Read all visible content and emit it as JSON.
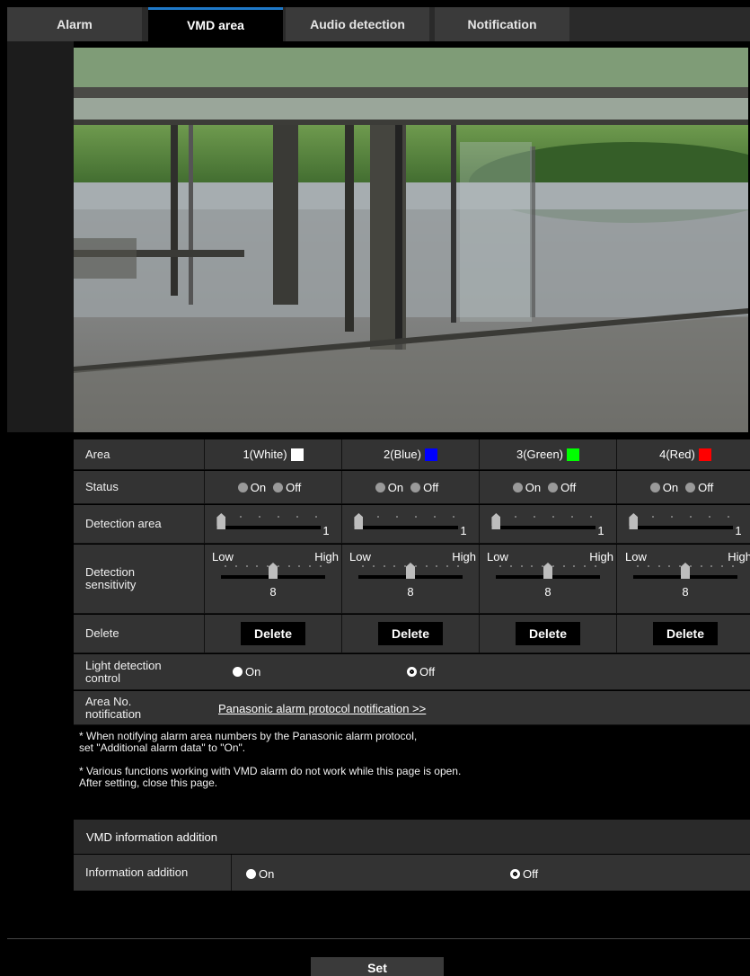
{
  "tabs": [
    {
      "label": "Alarm",
      "active": false
    },
    {
      "label": "VMD area",
      "active": true
    },
    {
      "label": "Audio detection",
      "active": false
    },
    {
      "label": "Notification",
      "active": false
    }
  ],
  "area_table": {
    "labels": {
      "area": "Area",
      "status": "Status",
      "detection_area": "Detection area",
      "detection_sensitivity": "Detection sensitivity",
      "delete": "Delete",
      "light_detection": "Light detection control",
      "area_no_notification": "Area No. notification"
    },
    "areas": [
      {
        "name": "1(White)",
        "color": "#ffffff",
        "status": "Off",
        "detection_area": "1",
        "sensitivity": "8",
        "sensitivity_level": 8
      },
      {
        "name": "2(Blue)",
        "color": "#0000ff",
        "status": "Off",
        "detection_area": "1",
        "sensitivity": "8",
        "sensitivity_level": 8
      },
      {
        "name": "3(Green)",
        "color": "#00ff00",
        "status": "Off",
        "detection_area": "1",
        "sensitivity": "8",
        "sensitivity_level": 8
      },
      {
        "name": "4(Red)",
        "color": "#ff0000",
        "status": "Off",
        "detection_area": "1",
        "sensitivity": "8",
        "sensitivity_level": 8
      }
    ],
    "on_label": "On",
    "off_label": "Off",
    "low_label": "Low",
    "high_label": "High",
    "delete_button": "Delete",
    "light_detection_value": "Off",
    "notification_link": "Panasonic alarm protocol notification >>"
  },
  "notes": {
    "note1_line1": "* When notifying alarm area numbers by the Panasonic alarm protocol,",
    "note1_line2": "set \"Additional alarm data\" to \"On\".",
    "note2_line1": "* Various functions working with VMD alarm do not work while this page is open.",
    "note2_line2": "After setting, close this page."
  },
  "vmd_info": {
    "title": "VMD information addition",
    "label": "Information addition",
    "value": "Off"
  },
  "set_button": "Set",
  "colors": {
    "accent_tab": "#1e78c8",
    "row_bg": "#333333"
  }
}
